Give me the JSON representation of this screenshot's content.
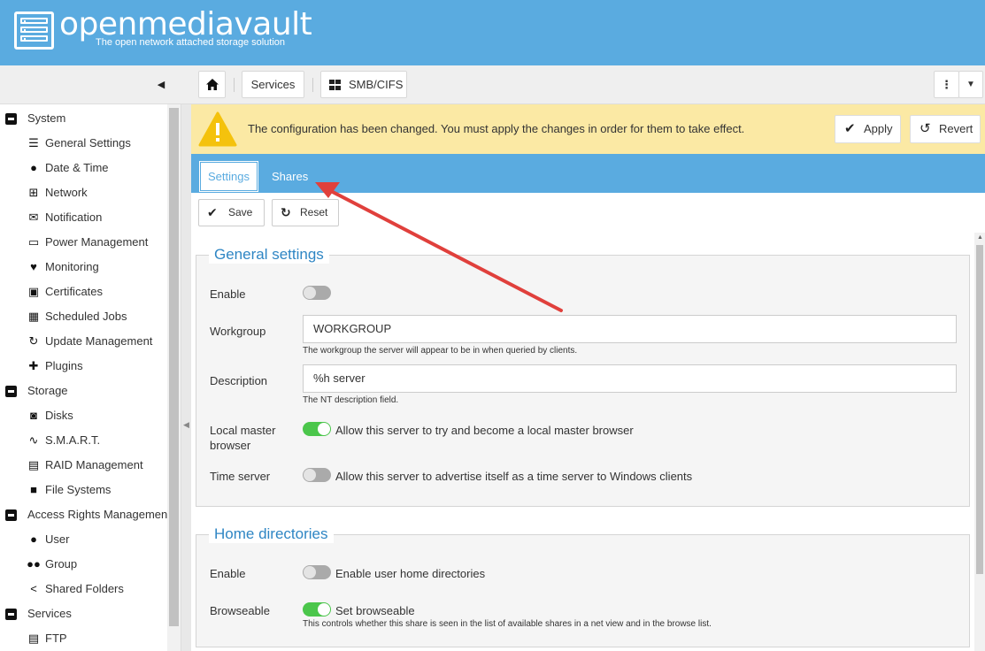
{
  "brand": {
    "name": "openmediavault",
    "tagline": "The open network attached storage solution"
  },
  "toolbar": {
    "home_icon": "home-icon",
    "crumb_services": "Services",
    "crumb_smb": "SMB/CIFS",
    "menu_icon": "⋮",
    "dropdown_icon": "▼",
    "collapse_icon": "◀"
  },
  "sidebar": {
    "groups": {
      "system": "System",
      "storage": "Storage",
      "access": "Access Rights Management",
      "services": "Services"
    },
    "items": {
      "general_settings": "General Settings",
      "date_time": "Date & Time",
      "network": "Network",
      "notification": "Notification",
      "power_management": "Power Management",
      "monitoring": "Monitoring",
      "certificates": "Certificates",
      "scheduled_jobs": "Scheduled Jobs",
      "update_management": "Update Management",
      "plugins": "Plugins",
      "disks": "Disks",
      "smart": "S.M.A.R.T.",
      "raid_management": "RAID Management",
      "file_systems": "File Systems",
      "user": "User",
      "group": "Group",
      "shared_folders": "Shared Folders",
      "ftp": "FTP"
    }
  },
  "warning": {
    "message": "The configuration has been changed. You must apply the changes in order for them to take effect.",
    "apply_label": "Apply",
    "revert_label": "Revert"
  },
  "tabs": {
    "settings": "Settings",
    "shares": "Shares"
  },
  "form_buttons": {
    "save": "Save",
    "reset": "Reset"
  },
  "general": {
    "legend": "General settings",
    "enable_label": "Enable",
    "enable_on": false,
    "workgroup_label": "Workgroup",
    "workgroup_value": "WORKGROUP",
    "workgroup_hint": "The workgroup the server will appear to be in when queried by clients.",
    "description_label": "Description",
    "description_value": "%h server",
    "description_hint": "The NT description field.",
    "local_master_label": "Local master browser",
    "local_master_on": true,
    "local_master_text": "Allow this server to try and become a local master browser",
    "time_server_label": "Time server",
    "time_server_on": false,
    "time_server_text": "Allow this server to advertise itself as a time server to Windows clients"
  },
  "home": {
    "legend": "Home directories",
    "enable_label": "Enable",
    "enable_on": false,
    "enable_text": "Enable user home directories",
    "browseable_label": "Browseable",
    "browseable_on": true,
    "browseable_text": "Set browseable",
    "browseable_hint": "This controls whether this share is seen in the list of available shares in a net view and in the browse list."
  },
  "colors": {
    "header": "#5aabe0",
    "warning_bg": "#fbe9a4",
    "legend": "#2f86c4",
    "toggle_on": "#4bc64b",
    "annotation_arrow": "#e0403c"
  }
}
